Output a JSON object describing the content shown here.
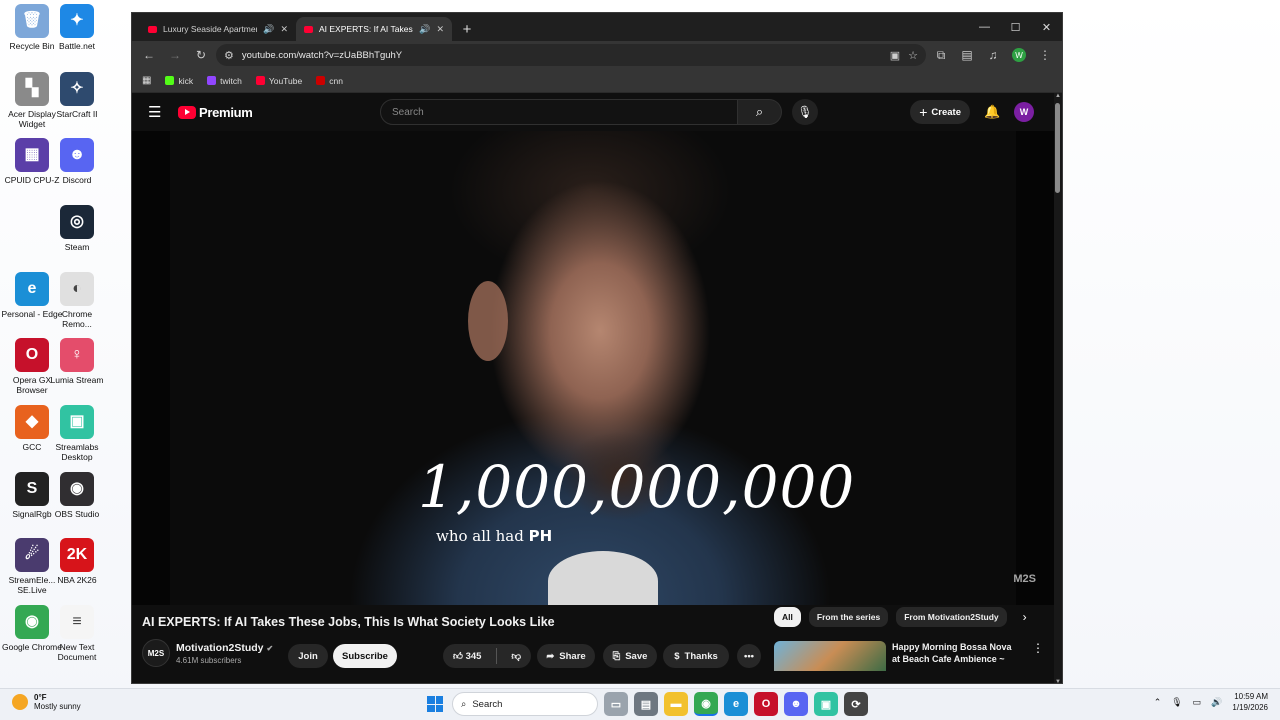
{
  "desktop": {
    "icons": [
      {
        "label": "Recycle Bin"
      },
      {
        "label": "Battle.net"
      },
      {
        "label": "Acer Display Widget"
      },
      {
        "label": "StarCraft II"
      },
      {
        "label": "CPUID CPU-Z"
      },
      {
        "label": "Discord"
      },
      {
        "label": "Steam"
      },
      {
        "label": "Personal - Edge"
      },
      {
        "label": "Chrome Remo..."
      },
      {
        "label": "Opera GX Browser"
      },
      {
        "label": "Lumia Stream"
      },
      {
        "label": "GCC"
      },
      {
        "label": "Streamlabs Desktop"
      },
      {
        "label": "SignalRgb"
      },
      {
        "label": "OBS Studio"
      },
      {
        "label": "StreamEle... SE.Live"
      },
      {
        "label": "NBA 2K26"
      },
      {
        "label": "Google Chrome"
      },
      {
        "label": "New Text Document"
      }
    ]
  },
  "browser": {
    "tabs": [
      {
        "title": "Luxury Seaside Apartment"
      },
      {
        "title": "AI EXPERTS: If AI Takes The"
      }
    ],
    "url": "youtube.com/watch?v=zUaBBhTguhY",
    "bookmarks": [
      {
        "label": "kick",
        "color": "#53fc18"
      },
      {
        "label": "twitch",
        "color": "#9146ff"
      },
      {
        "label": "YouTube",
        "color": "#ff0033"
      },
      {
        "label": "cnn",
        "color": "#cc0000"
      }
    ],
    "profile_initial": "W"
  },
  "youtube": {
    "logo_text": "Premium",
    "search_placeholder": "Search",
    "create_label": "Create",
    "avatar_initial": "W",
    "caption_big": "1,000,000,000",
    "caption_small_pre": "who all had",
    "caption_small_bold": "PH",
    "watermark": "M2S",
    "video_title": "AI EXPERTS: If AI Takes These Jobs, This Is What Society Looks Like",
    "channel_name": "Motivation2Study",
    "channel_logo": "M2S",
    "subscribers": "4.61M subscribers",
    "join_label": "Join",
    "subscribe_label": "Subscribe",
    "like_count": "345",
    "share_label": "Share",
    "save_label": "Save",
    "thanks_label": "Thanks",
    "chips": [
      "All",
      "From the series",
      "From Motivation2Study"
    ],
    "rec_title": "Happy Morning Bossa Nova at Beach Cafe Ambience ~"
  },
  "taskbar": {
    "temp": "0°F",
    "weather": "Mostly sunny",
    "search_label": "Search",
    "time": "10:59 AM",
    "date": "1/19/2026"
  }
}
